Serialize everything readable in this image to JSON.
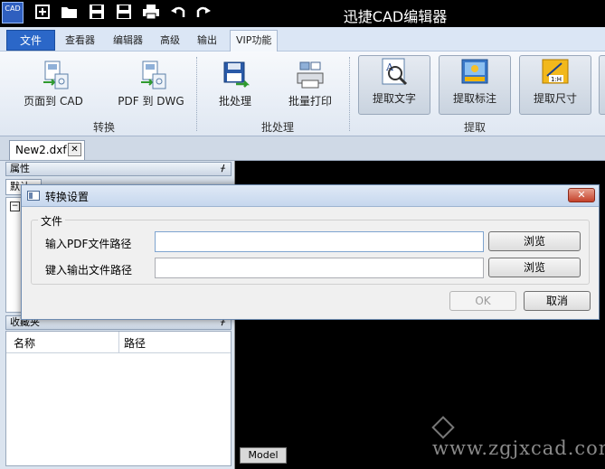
{
  "app": {
    "logo_text": "CAD",
    "title": "迅捷CAD编辑器"
  },
  "quick_access": [
    "new-icon",
    "open-icon",
    "save-icon",
    "saveas-icon",
    "print-icon",
    "undo-icon",
    "redo-icon"
  ],
  "ribbon_tabs": [
    {
      "label": "文件"
    },
    {
      "label": "查看器"
    },
    {
      "label": "编辑器"
    },
    {
      "label": "高级"
    },
    {
      "label": "输出"
    },
    {
      "label": "VIP功能"
    }
  ],
  "ribbon": {
    "buttons": [
      {
        "label": "页面到 CAD"
      },
      {
        "label": "PDF 到 DWG"
      },
      {
        "label": "批处理"
      },
      {
        "label": "批量打印"
      },
      {
        "label": "提取文字"
      },
      {
        "label": "提取标注"
      },
      {
        "label": "提取尺寸"
      }
    ],
    "groups": [
      {
        "label": "转换"
      },
      {
        "label": "批处理"
      },
      {
        "label": "提取"
      }
    ]
  },
  "document": {
    "tab_label": "New2.dxf",
    "close_glyph": "✕"
  },
  "panels": {
    "properties": {
      "title": "属性",
      "pin": "ᚋ",
      "tab_label": "默认",
      "expander": "−"
    },
    "favorites": {
      "title": "收藏夹",
      "pin": "ᚋ",
      "col_name": "名称",
      "col_path": "路径"
    }
  },
  "canvas": {
    "model_tab": "Model",
    "watermark": "www.zgjxcad.com"
  },
  "dialog": {
    "title": "转换设置",
    "close_glyph": "✕",
    "group_label": "文件",
    "input_label": "输入PDF文件路径",
    "input_value": "",
    "output_label": "键入输出文件路径",
    "output_value": "",
    "browse_label": "浏览",
    "ok_label": "OK",
    "cancel_label": "取消"
  }
}
